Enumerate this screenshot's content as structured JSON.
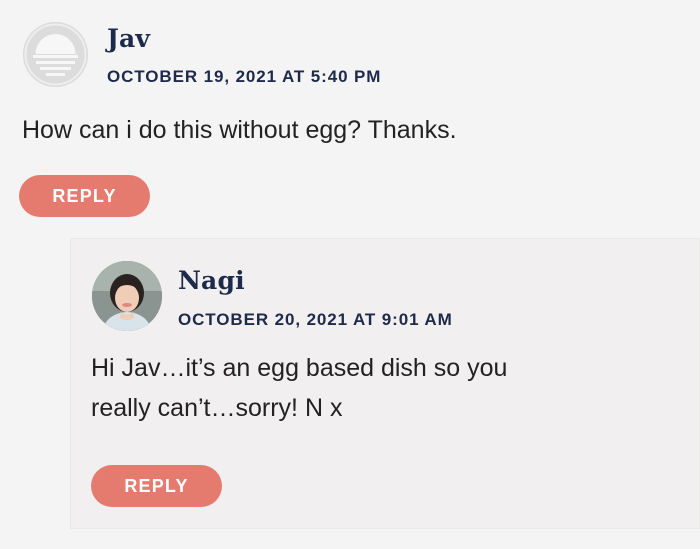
{
  "comments": [
    {
      "author": "Jav",
      "date": "OCTOBER 19, 2021 AT 5:40 PM",
      "text": "How can i do this without egg? Thanks.",
      "reply_label": "REPLY",
      "avatar": "generic-avatar-icon"
    },
    {
      "author": "Nagi",
      "date": "OCTOBER 20, 2021 AT 9:01 AM",
      "text_lines": [
        "Hi Jav…it’s an egg based dish so you",
        "really can’t…sorry! N x"
      ],
      "reply_label": "REPLY",
      "avatar": "author-photo"
    }
  ],
  "colors": {
    "background": "#f4f4f4",
    "reply_nested_bg": "#f1efef",
    "name": "#1e2a4a",
    "reply_button": "#e57b6f"
  }
}
